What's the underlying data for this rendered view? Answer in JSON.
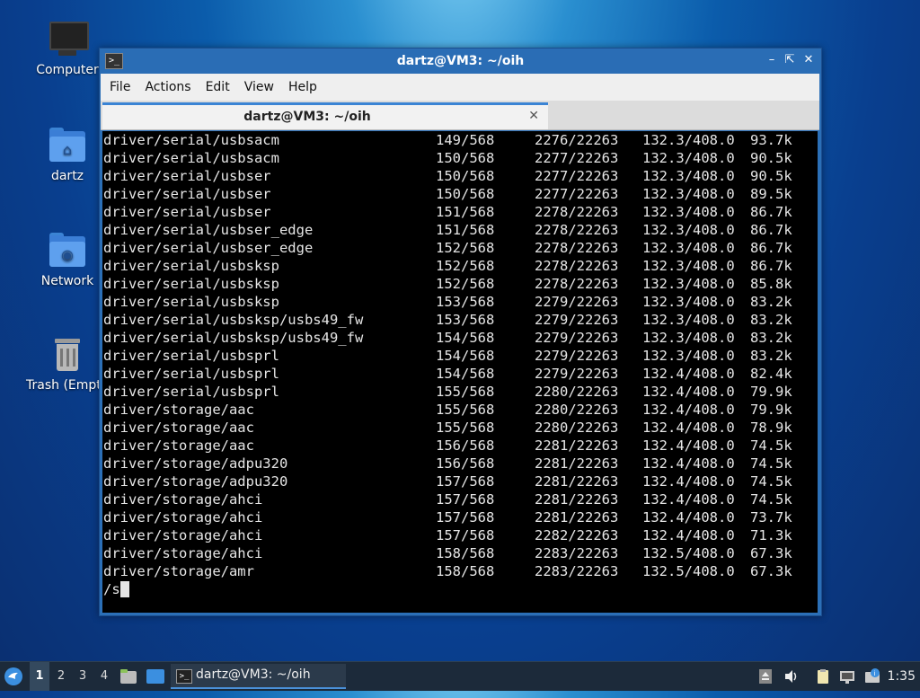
{
  "desktop": {
    "icons": [
      {
        "label": "Computer"
      },
      {
        "label": "dartz"
      },
      {
        "label": "Network"
      },
      {
        "label": "Trash (Empty)"
      }
    ]
  },
  "window": {
    "title": "dartz@VM3: ~/oih",
    "menu": [
      "File",
      "Actions",
      "Edit",
      "View",
      "Help"
    ],
    "tab_label": "dartz@VM3: ~/oih"
  },
  "terminal": {
    "rows": [
      [
        "driver/serial/usbsacm",
        "149/568",
        "2276/22263",
        "132.3/408.0",
        "93.7k"
      ],
      [
        "driver/serial/usbsacm",
        "150/568",
        "2277/22263",
        "132.3/408.0",
        "90.5k"
      ],
      [
        "driver/serial/usbser",
        "150/568",
        "2277/22263",
        "132.3/408.0",
        "90.5k"
      ],
      [
        "driver/serial/usbser",
        "150/568",
        "2277/22263",
        "132.3/408.0",
        "89.5k"
      ],
      [
        "driver/serial/usbser",
        "151/568",
        "2278/22263",
        "132.3/408.0",
        "86.7k"
      ],
      [
        "driver/serial/usbser_edge",
        "151/568",
        "2278/22263",
        "132.3/408.0",
        "86.7k"
      ],
      [
        "driver/serial/usbser_edge",
        "152/568",
        "2278/22263",
        "132.3/408.0",
        "86.7k"
      ],
      [
        "driver/serial/usbsksp",
        "152/568",
        "2278/22263",
        "132.3/408.0",
        "86.7k"
      ],
      [
        "driver/serial/usbsksp",
        "152/568",
        "2278/22263",
        "132.3/408.0",
        "85.8k"
      ],
      [
        "driver/serial/usbsksp",
        "153/568",
        "2279/22263",
        "132.3/408.0",
        "83.2k"
      ],
      [
        "driver/serial/usbsksp/usbs49_fw",
        "153/568",
        "2279/22263",
        "132.3/408.0",
        "83.2k"
      ],
      [
        "driver/serial/usbsksp/usbs49_fw",
        "154/568",
        "2279/22263",
        "132.3/408.0",
        "83.2k"
      ],
      [
        "driver/serial/usbsprl",
        "154/568",
        "2279/22263",
        "132.3/408.0",
        "83.2k"
      ],
      [
        "driver/serial/usbsprl",
        "154/568",
        "2279/22263",
        "132.4/408.0",
        "82.4k"
      ],
      [
        "driver/serial/usbsprl",
        "155/568",
        "2280/22263",
        "132.4/408.0",
        "79.9k"
      ],
      [
        "driver/storage/aac",
        "155/568",
        "2280/22263",
        "132.4/408.0",
        "79.9k"
      ],
      [
        "driver/storage/aac",
        "155/568",
        "2280/22263",
        "132.4/408.0",
        "78.9k"
      ],
      [
        "driver/storage/aac",
        "156/568",
        "2281/22263",
        "132.4/408.0",
        "74.5k"
      ],
      [
        "driver/storage/adpu320",
        "156/568",
        "2281/22263",
        "132.4/408.0",
        "74.5k"
      ],
      [
        "driver/storage/adpu320",
        "157/568",
        "2281/22263",
        "132.4/408.0",
        "74.5k"
      ],
      [
        "driver/storage/ahci",
        "157/568",
        "2281/22263",
        "132.4/408.0",
        "74.5k"
      ],
      [
        "driver/storage/ahci",
        "157/568",
        "2281/22263",
        "132.4/408.0",
        "73.7k"
      ],
      [
        "driver/storage/ahci",
        "157/568",
        "2282/22263",
        "132.4/408.0",
        "71.3k"
      ],
      [
        "driver/storage/ahci",
        "158/568",
        "2283/22263",
        "132.5/408.0",
        "67.3k"
      ],
      [
        "driver/storage/amr",
        "158/568",
        "2283/22263",
        "132.5/408.0",
        "67.3k"
      ]
    ],
    "prompt_text": "/s"
  },
  "taskbar": {
    "workspaces": [
      "1",
      "2",
      "3",
      "4"
    ],
    "active_workspace": "1",
    "task_label": "dartz@VM3: ~/oih",
    "tray_icons": [
      "upload-icon",
      "volume-icon",
      "clipboard-icon",
      "network-icon",
      "notification-icon"
    ],
    "clock": "1:35"
  },
  "colors": {
    "titlebar": "#2a6db5",
    "terminal_bg": "#000000",
    "terminal_fg": "#e6e6e6",
    "taskbar": "#1c2a3a"
  }
}
